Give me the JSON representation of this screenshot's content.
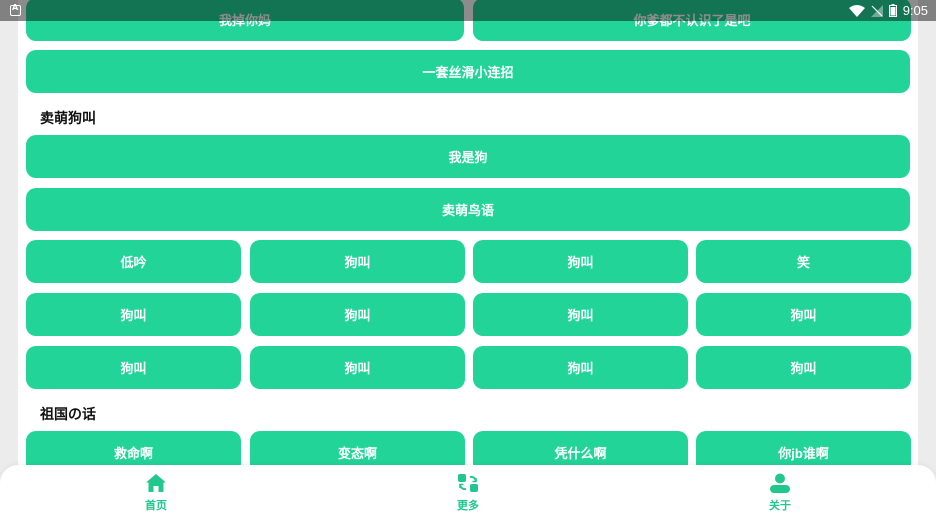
{
  "status_bar": {
    "time": "9:05"
  },
  "top_buttons": [
    {
      "label": "我掉你妈"
    },
    {
      "label": "你爹都不认识了是吧"
    }
  ],
  "combo_button": {
    "label": "一套丝滑小连招"
  },
  "sections": [
    {
      "title": "卖萌狗叫",
      "wide_buttons": [
        "我是狗",
        "卖萌鸟语"
      ],
      "grid": [
        [
          "低吟",
          "狗叫",
          "狗叫",
          "笑"
        ],
        [
          "狗叫",
          "狗叫",
          "狗叫",
          "狗叫"
        ],
        [
          "狗叫",
          "狗叫",
          "狗叫",
          "狗叫"
        ]
      ]
    },
    {
      "title": "祖国の话",
      "grid": [
        [
          "救命啊",
          "变态啊",
          "凭什么啊",
          "你jb谁啊"
        ]
      ]
    }
  ],
  "tabbar": {
    "items": [
      {
        "label": "首页",
        "icon": "home-icon"
      },
      {
        "label": "更多",
        "icon": "more-icon"
      },
      {
        "label": "关于",
        "icon": "person-icon"
      }
    ]
  },
  "colors": {
    "accent": "#22d498",
    "tab_accent": "#22c78d",
    "background": "#ffffff",
    "page_bg": "#ececec"
  }
}
